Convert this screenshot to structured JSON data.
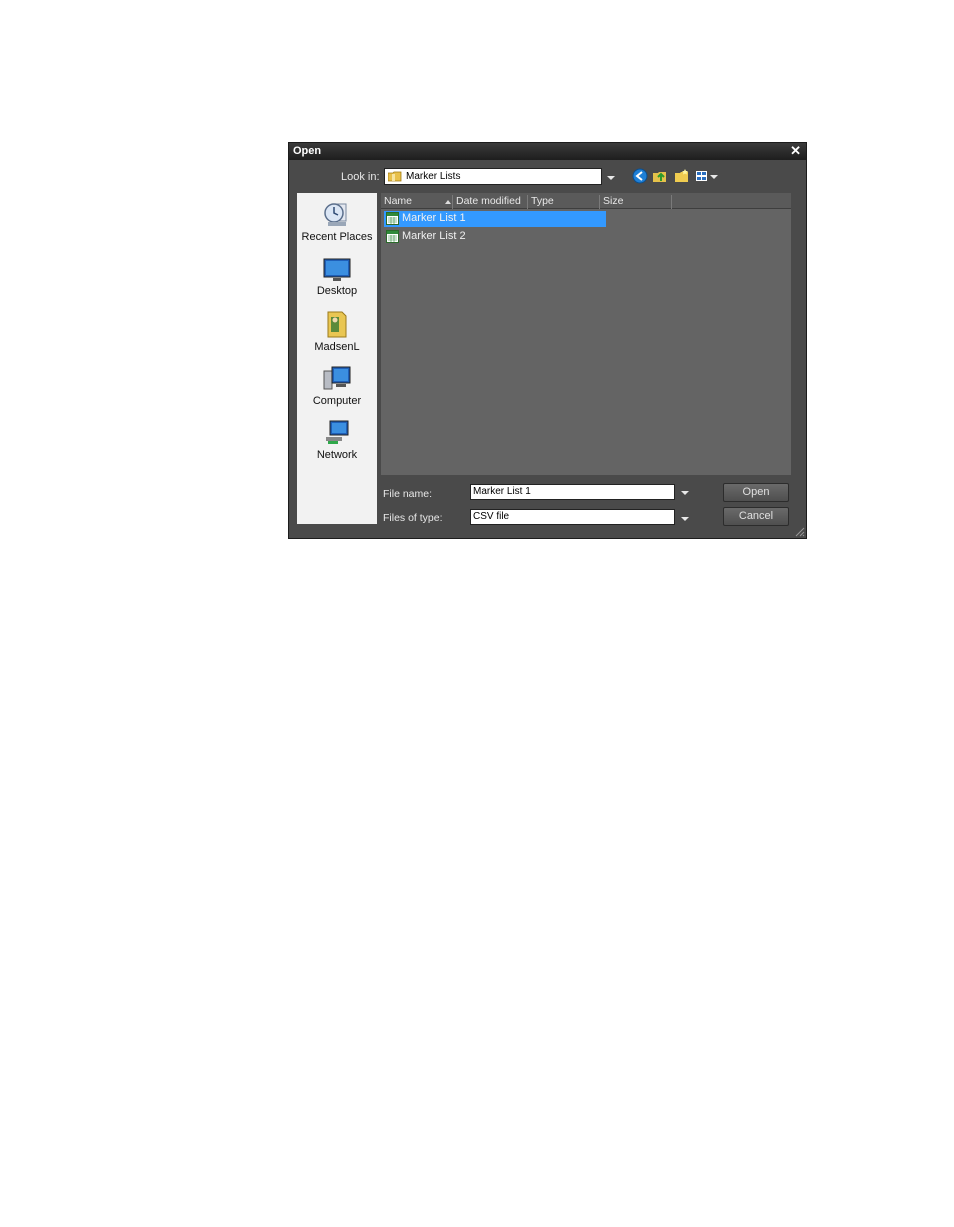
{
  "dialog": {
    "title": "Open",
    "close_glyph": "✕"
  },
  "toolbar": {
    "lookin_label": "Look in:",
    "lookin_value": "Marker Lists",
    "icons": [
      "back-icon",
      "up-folder-icon",
      "new-folder-icon",
      "view-menu-icon"
    ]
  },
  "places": [
    {
      "label": "Recent Places",
      "icon": "recent-places-icon"
    },
    {
      "label": "Desktop",
      "icon": "desktop-icon"
    },
    {
      "label": "MadsenL",
      "icon": "user-folder-icon"
    },
    {
      "label": "Computer",
      "icon": "computer-icon"
    },
    {
      "label": "Network",
      "icon": "network-icon"
    }
  ],
  "filelist": {
    "columns": [
      "Name",
      "Date modified",
      "Type",
      "Size"
    ],
    "files": [
      {
        "name": "Marker List 1",
        "selected": true
      },
      {
        "name": "Marker List 2",
        "selected": false
      }
    ]
  },
  "footer": {
    "filename_label": "File name:",
    "filename_value": "Marker List 1",
    "filetype_label": "Files of type:",
    "filetype_value": "CSV file",
    "open_label": "Open",
    "cancel_label": "Cancel"
  },
  "colors": {
    "selection": "#3399ff",
    "dialog_bg": "#4a4a4a",
    "list_bg": "#646464"
  }
}
